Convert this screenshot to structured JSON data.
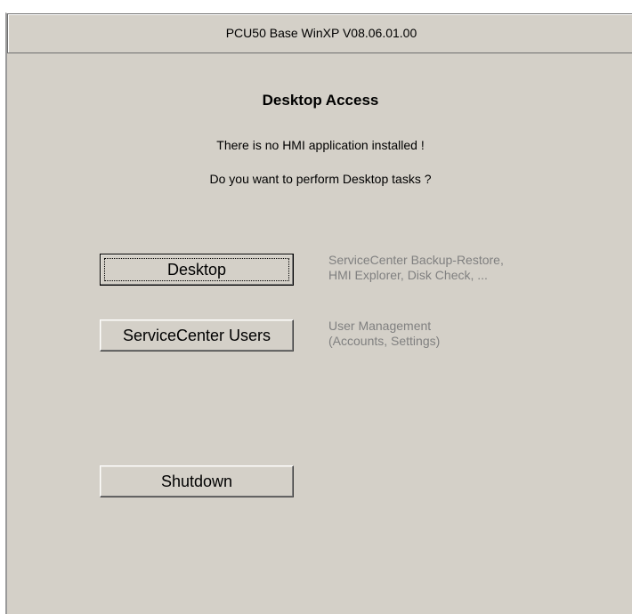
{
  "window": {
    "title": "PCU50 Base WinXP V08.06.01.00"
  },
  "main": {
    "heading": "Desktop Access",
    "message_line1": "There is no HMI application installed !",
    "message_line2": "Do you want to perform Desktop tasks ?"
  },
  "buttons": {
    "desktop": {
      "label": "Desktop",
      "description_line1": "ServiceCenter Backup-Restore,",
      "description_line2": "HMI Explorer, Disk Check, ..."
    },
    "users": {
      "label": "ServiceCenter Users",
      "description_line1": "User Management",
      "description_line2": "(Accounts, Settings)"
    },
    "shutdown": {
      "label": "Shutdown"
    }
  }
}
